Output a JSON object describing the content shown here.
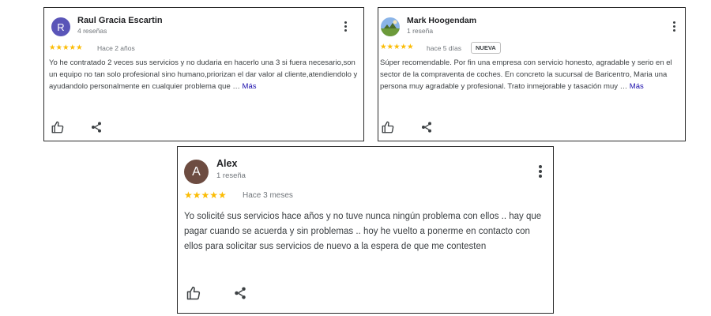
{
  "reviews": [
    {
      "avatar_letter": "R",
      "avatar_color": "#5a55b8",
      "name": "Raul Gracia Escartin",
      "review_count": "4 reseñas",
      "stars": "★★★★★",
      "rating": 5,
      "date": "Hace 2 años",
      "text": "Yo he contratado 2 veces sus servicios y no dudaria en hacerlo una 3 si fuera necesario,son un equipo no tan solo profesional sino humano,priorizan el dar valor al cliente,atendiendolo y ayudandolo personalmente en cualquier problema que … ",
      "more_label": "Más"
    },
    {
      "avatar_icon": "landscape-photo-icon",
      "name": "Mark Hoogendam",
      "review_count": "1 reseña",
      "stars": "★★★★★",
      "rating": 5,
      "date": "hace 5 días",
      "badge": "NUEVA",
      "text": "Súper recomendable. Por fin una empresa con servicio honesto, agradable y serio en el sector de la compraventa de coches. En concreto la sucursal de Baricentro, Maria una persona muy agradable y profesional. Trato inmejorable y tasación muy … ",
      "more_label": "Más"
    },
    {
      "avatar_letter": "A",
      "avatar_color": "#6d4c41",
      "name": "Alex",
      "review_count": "1 reseña",
      "stars": "★★★★★",
      "rating": 5,
      "date": "Hace 3 meses",
      "text": "Yo solicité sus servicios hace años y no tuve nunca ningún problema con ellos .. hay que pagar cuando se acuerda y sin problemas .. hoy he vuelto a ponerme en contacto con ellos para solicitar sus servicios de nuevo a la espera de que me contesten"
    }
  ],
  "icons": {
    "like": "thumbs-up-icon",
    "share": "share-icon",
    "menu": "more-vert-icon"
  },
  "colors": {
    "star": "#fbbc04",
    "link": "#1a0dab",
    "border": "#2b2b2b"
  }
}
